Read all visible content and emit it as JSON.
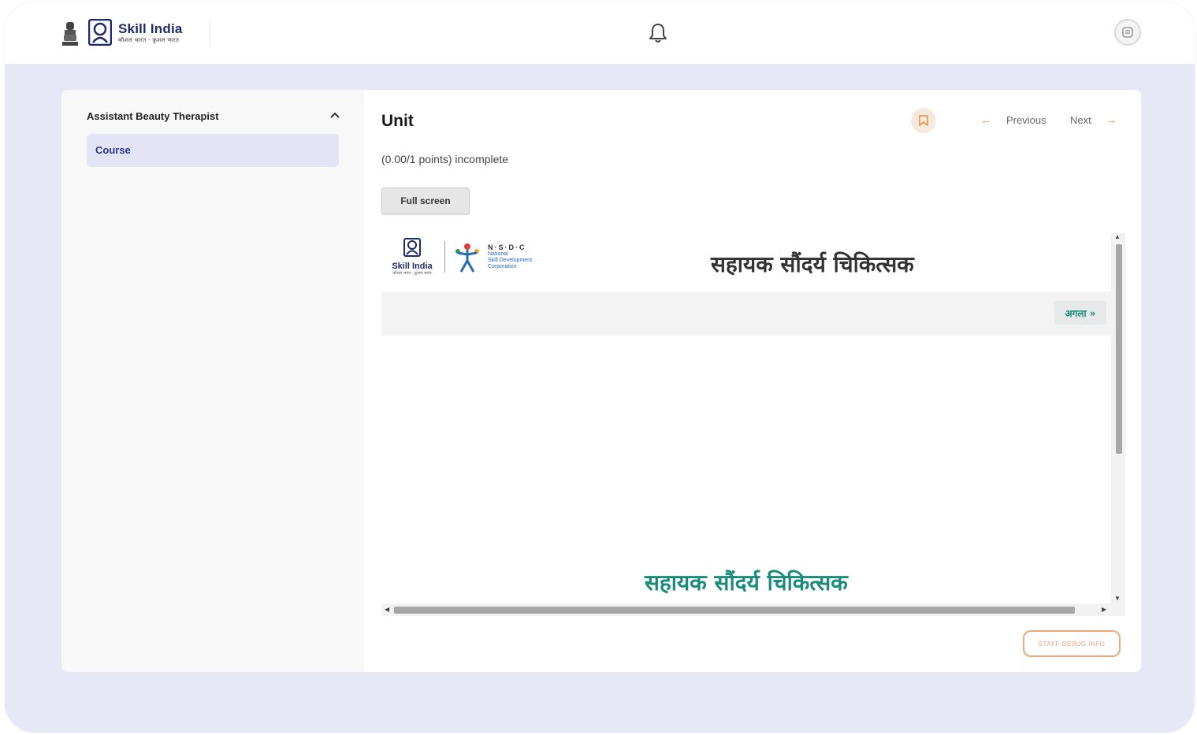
{
  "header": {
    "brand": "Skill India",
    "brand_tagline": "कौशल भारत - कुशल भारत",
    "icons": [
      "emblem-icon",
      "skill-india-logo-icon",
      "bell-icon",
      "user-icon"
    ]
  },
  "sidebar": {
    "course_title": "Assistant Beauty Therapist",
    "items": [
      {
        "label": "Course"
      }
    ]
  },
  "unit": {
    "title": "Unit",
    "points": "(0.00/1 points) incomplete",
    "fullscreen_label": "Full screen",
    "previous_label": "Previous",
    "next_label": "Next"
  },
  "content": {
    "skill_logo_text": "Skill India",
    "skill_logo_sub": "कौशल भारत - कुशल भारत",
    "nsdc_abbr": "N·S·D·C",
    "nsdc_line1": "National",
    "nsdc_line2": "Skill Development",
    "nsdc_line3": "Corporation",
    "heading": "सहायक सौंदर्य चिकित्सक",
    "next_button": "अगला »",
    "subheading": "सहायक सौंदर्य चिकित्सक"
  },
  "footer": {
    "debug_label": "STAFF DEBUG INFO"
  },
  "colors": {
    "background": "#e7e8f6",
    "accent_orange": "#e79a5a",
    "nav_active_bg": "#e3e5f7",
    "nav_active_text": "#2d3590",
    "teal": "#1b8b7a"
  }
}
